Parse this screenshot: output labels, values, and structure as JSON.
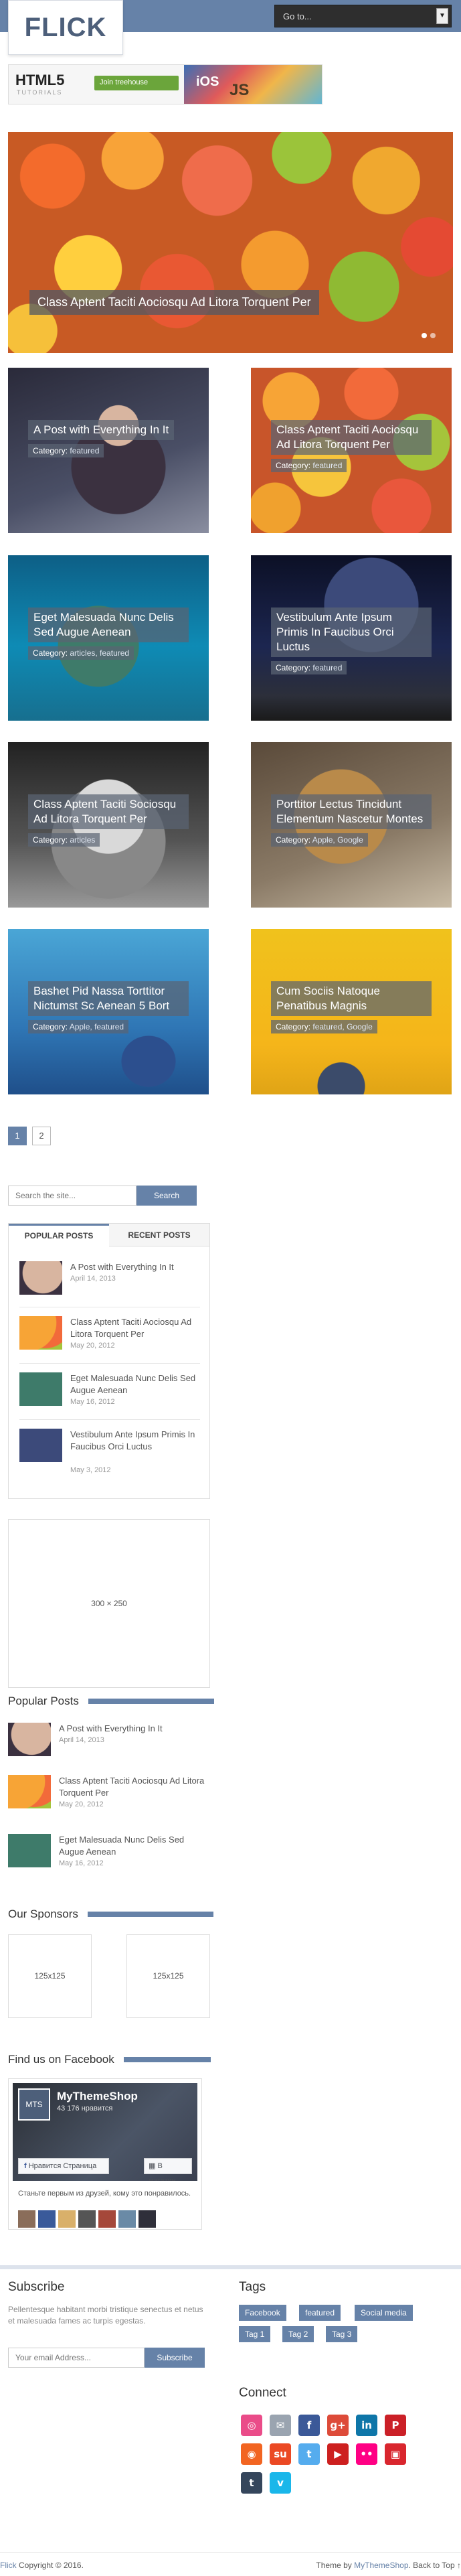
{
  "header": {
    "logo": "FLICK",
    "goto_select": "Go to..."
  },
  "banner": {
    "html5": "HTML5",
    "tutorials": "TUTORIALS",
    "treehouse": "Join treehouse",
    "ios": "iOS",
    "js": "JS"
  },
  "featured": {
    "caption": "Class Aptent Taciti Aociosqu Ad Litora Torquent Per"
  },
  "posts": [
    {
      "title": "A Post with Everything In It",
      "cat_label": "Category:",
      "cats": "featured"
    },
    {
      "title": "Class Aptent Taciti Aociosqu Ad Litora Torquent Per",
      "cat_label": "Category:",
      "cats": "featured"
    },
    {
      "title": "Eget Malesuada Nunc Delis Sed Augue Aenean",
      "cat_label": "Category:",
      "cats": "articles, featured"
    },
    {
      "title": "Vestibulum Ante Ipsum Primis In Faucibus Orci Luctus",
      "cat_label": "Category:",
      "cats": "featured"
    },
    {
      "title": "Class Aptent Taciti Sociosqu Ad Litora Torquent Per",
      "cat_label": "Category:",
      "cats": "articles"
    },
    {
      "title": "Porttitor Lectus Tincidunt Elementum Nascetur Montes",
      "cat_label": "Category:",
      "cats": "Apple, Google"
    },
    {
      "title": "Bashet Pid Nassa Torttitor Nictumst Sc Aenean 5 Bort",
      "cat_label": "Category:",
      "cats": "Apple, featured"
    },
    {
      "title": "Cum Sociis Natoque Penatibus Magnis",
      "cat_label": "Category:",
      "cats": "featured, Google"
    }
  ],
  "pagination": [
    "1",
    "2"
  ],
  "search": {
    "placeholder": "Search the site...",
    "button": "Search"
  },
  "tabs": {
    "popular_label": "POPULAR POSTS",
    "recent_label": "RECENT POSTS",
    "items": [
      {
        "title": "A Post with Everything In It",
        "date": "April 14, 2013"
      },
      {
        "title": "Class Aptent Taciti Aociosqu Ad Litora Torquent Per",
        "date": "May 20, 2012"
      },
      {
        "title": "Eget Malesuada Nunc Delis Sed Augue Aenean",
        "date": "May 16, 2012"
      },
      {
        "title": "Vestibulum Ante Ipsum Primis In Faucibus Orci Luctus",
        "date": "May 3, 2012"
      }
    ]
  },
  "ad300": "300 × 250",
  "popular_widget": {
    "title": "Popular Posts",
    "items": [
      {
        "title": "A Post with Everything In It",
        "date": "April 14, 2013"
      },
      {
        "title": "Class Aptent Taciti Aociosqu Ad Litora Torquent Per",
        "date": "May 20, 2012"
      },
      {
        "title": "Eget Malesuada Nunc Delis Sed Augue Aenean",
        "date": "May 16, 2012"
      }
    ]
  },
  "sponsors": {
    "title": "Our Sponsors",
    "ad1": "125x125",
    "ad2": "125x125"
  },
  "facebook": {
    "title": "Find us on Facebook",
    "page_name": "MyThemeShop",
    "likes": "43 176 нравится",
    "like_btn": "Нравится Страница",
    "shop_btn": "В магазин",
    "friends": "Станьте первым из друзей, кому это понравилось."
  },
  "subscribe": {
    "title": "Subscribe",
    "text": "Pellentesque habitant morbi tristique senectus et netus et malesuada fames ac turpis egestas.",
    "placeholder": "Your email Address...",
    "button": "Subscribe"
  },
  "tags": {
    "title": "Tags",
    "items": [
      "Facebook",
      "featured",
      "Social media",
      "Tag 1",
      "Tag 2",
      "Tag 3"
    ]
  },
  "connect": {
    "title": "Connect",
    "icons": [
      "dribbble-icon",
      "email-icon",
      "facebook-icon",
      "googleplus-icon",
      "linkedin-icon",
      "pinterest-icon",
      "rss-icon",
      "stumbleupon-icon",
      "twitter-icon",
      "youtube-icon",
      "flickr-icon",
      "delicious-icon",
      "tumblr-icon",
      "vimeo-icon"
    ]
  },
  "footer": {
    "brand": "Flick",
    "copyright": " Copyright © 2016.",
    "theme_by": "Theme by ",
    "theme_link": "MyThemeShop",
    "back_to_top": ". Back to Top ↑"
  },
  "colors": {
    "accent": "#6682a8"
  }
}
